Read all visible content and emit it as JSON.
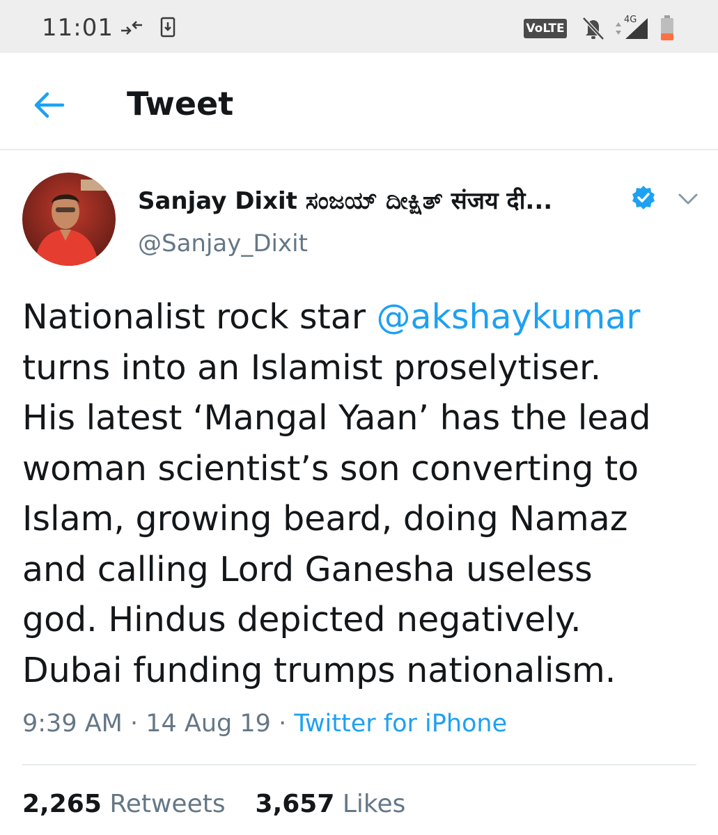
{
  "status_bar": {
    "time": "11:01",
    "icons": [
      "data-transfer-icon",
      "download-icon",
      "volte-icon",
      "mute-icon",
      "signal-4g-icon",
      "battery-low-icon"
    ],
    "volte_label": "VoLTE",
    "network_label": "4G",
    "battery_color": "#ff7043"
  },
  "app_bar": {
    "title": "Tweet",
    "back_icon": "back-arrow-icon",
    "accent_color": "#1da1f2"
  },
  "tweet": {
    "author": {
      "display_name": "Sanjay Dixit ಸಂಜಯ್ ದೀಕ್ಷಿತ್ संजय दी...",
      "handle": "@Sanjay_Dixit",
      "verified": true
    },
    "text_lines": [
      {
        "before": "Nationalist rock star ",
        "mention": "@akshaykumar"
      },
      {
        "before": "turns into an Islamist proselytiser."
      },
      {
        "before": "His latest ‘Mangal Yaan’ has the lead"
      },
      {
        "before": "woman scientist’s son converting to"
      },
      {
        "before": "Islam, growing beard, doing Namaz"
      },
      {
        "before": "and calling Lord Ganesha useless"
      },
      {
        "before": "god. Hindus depicted negatively."
      },
      {
        "before": "Dubai funding trumps nationalism."
      }
    ],
    "time": "9:39 AM",
    "separator": " · ",
    "date": "14 Aug 19",
    "source": "Twitter for iPhone",
    "retweets_count": "2,265",
    "retweets_label": "Retweets",
    "likes_count": "3,657",
    "likes_label": "Likes"
  }
}
